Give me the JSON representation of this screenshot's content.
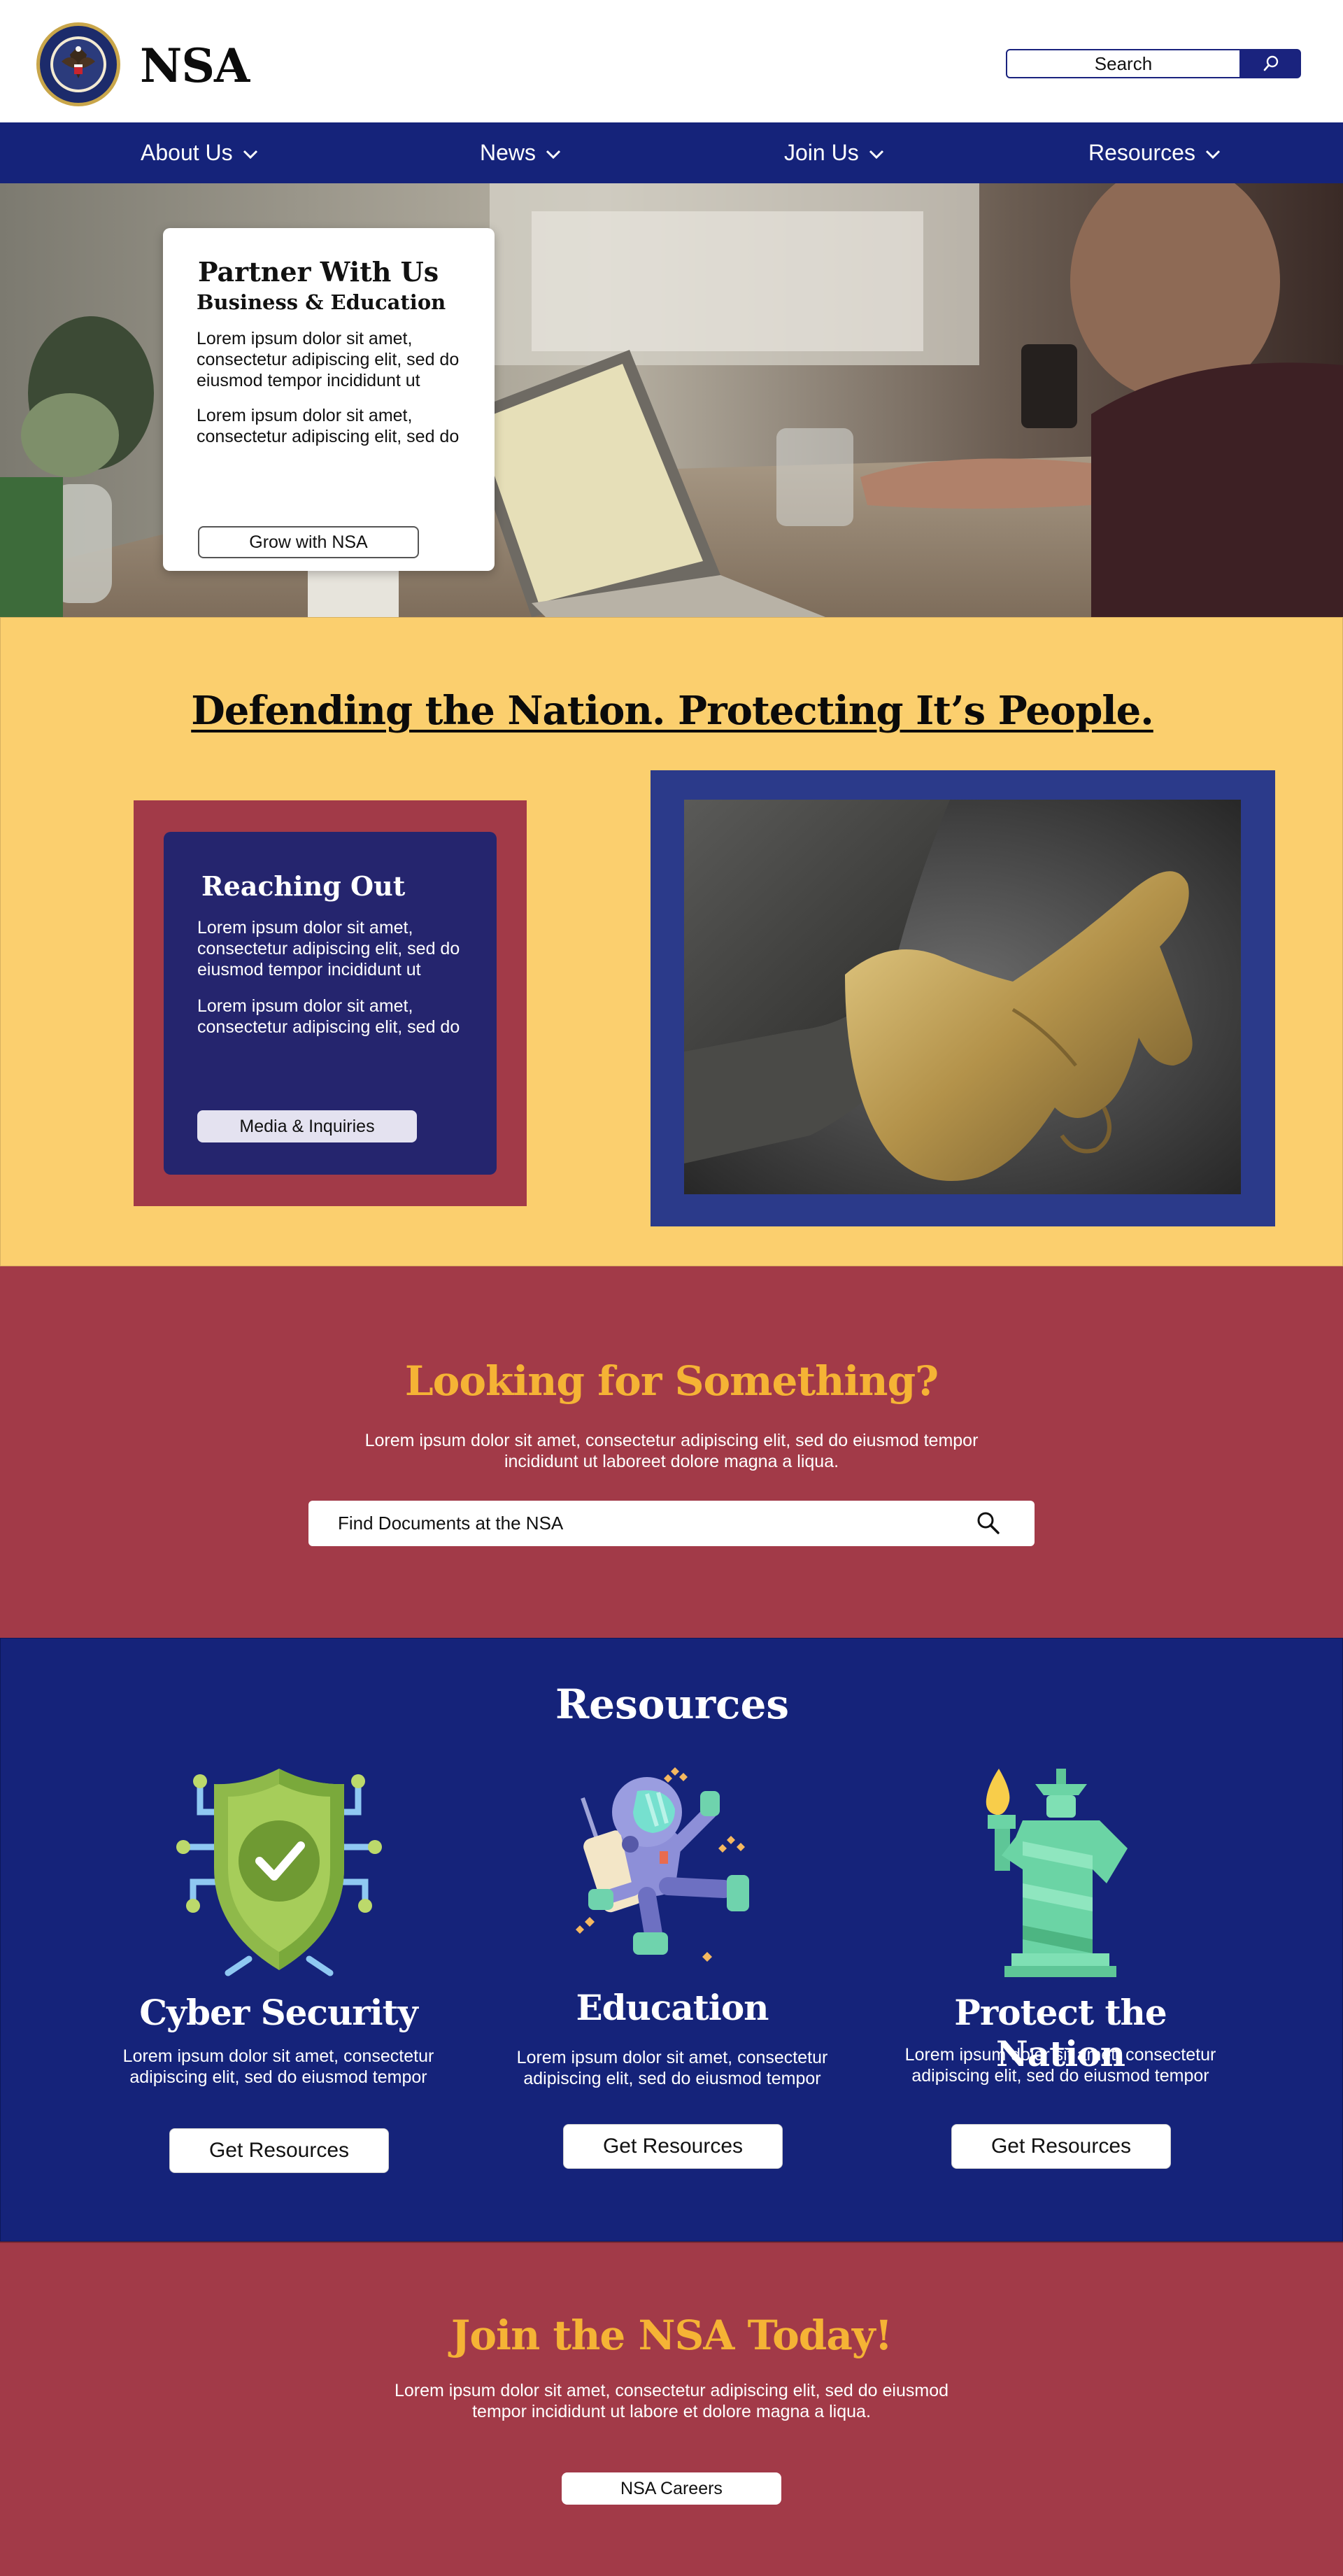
{
  "header": {
    "brand": "NSA",
    "search_placeholder": "Search"
  },
  "nav": {
    "items": [
      {
        "label": "About Us"
      },
      {
        "label": "News"
      },
      {
        "label": "Join Us"
      },
      {
        "label": "Resources"
      }
    ]
  },
  "hero": {
    "title": "Partner With Us",
    "subtitle": "Business & Education",
    "paragraph_1": "Lorem ipsum dolor sit amet, consectetur adipiscing elit, sed do eiusmod tempor incididunt ut",
    "paragraph_2": "Lorem ipsum dolor sit amet, consectetur adipiscing elit, sed do",
    "button": "Grow with NSA"
  },
  "mission": {
    "title": "Defending the Nation. Protecting It’s People.",
    "card": {
      "title": "Reaching Out",
      "paragraph_1": "Lorem ipsum dolor sit amet, consectetur adipiscing elit, sed do eiusmod tempor incididunt ut",
      "paragraph_2": "Lorem ipsum dolor sit amet, consectetur adipiscing elit, sed do",
      "button": "Media & Inquiries"
    }
  },
  "find": {
    "title": "Looking for Something?",
    "description": "Lorem ipsum dolor sit amet, consectetur adipiscing elit, sed do eiusmod tempor incididunt ut laboreet dolore magna a liqua.",
    "placeholder": "Find Documents at the NSA"
  },
  "resources": {
    "title": "Resources",
    "items": [
      {
        "name": "Cyber Security",
        "description": "Lorem ipsum dolor sit amet, consectetur adipiscing elit, sed do eiusmod tempor",
        "button": "Get Resources",
        "icon": "shield-check-icon"
      },
      {
        "name": "Education",
        "description": "Lorem ipsum dolor sit amet, consectetur adipiscing elit, sed do eiusmod tempor",
        "button": "Get Resources",
        "icon": "astronaut-icon"
      },
      {
        "name": "Protect the Nation",
        "description": "Lorem ipsum dolor sit amet, consectetur adipiscing elit, sed do eiusmod tempor",
        "button": "Get Resources",
        "icon": "statue-of-liberty-icon"
      }
    ]
  },
  "join": {
    "title": "Join the NSA Today!",
    "description": "Lorem ipsum dolor sit amet, consectetur adipiscing elit, sed do eiusmod tempor incididunt ut labore et dolore magna a liqua.",
    "button": "NSA Careers"
  },
  "colors": {
    "navy": "#15237a",
    "maroon": "#a23a48",
    "gold": "#fbcf6e",
    "accent_orange": "#f5b335"
  }
}
